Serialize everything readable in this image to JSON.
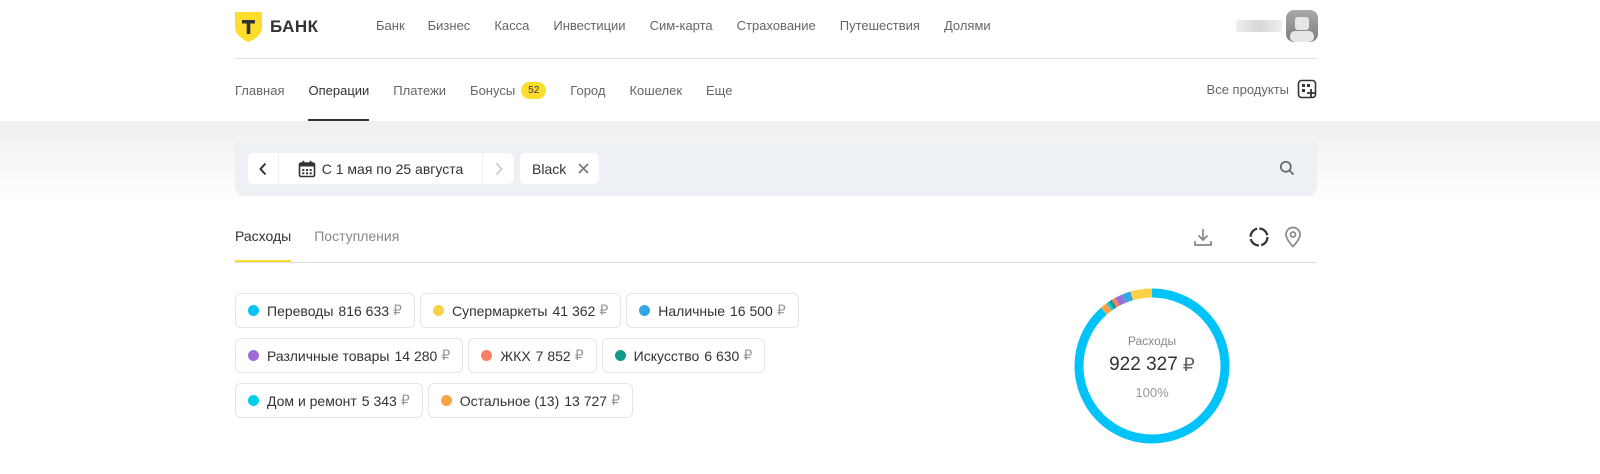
{
  "brand": {
    "logo_letter": "Т",
    "name": "БАНК",
    "accent": "#ffdd2d"
  },
  "top_nav": [
    "Банк",
    "Бизнес",
    "Касса",
    "Инвестиции",
    "Сим-карта",
    "Страхование",
    "Путешествия",
    "Долями"
  ],
  "sub_nav": {
    "items": [
      {
        "label": "Главная",
        "active": false
      },
      {
        "label": "Операции",
        "active": true
      },
      {
        "label": "Платежи",
        "active": false
      },
      {
        "label": "Бонусы",
        "badge": "52",
        "active": false
      },
      {
        "label": "Город",
        "active": false
      },
      {
        "label": "Кошелек",
        "active": false
      },
      {
        "label": "Еще",
        "active": false
      }
    ],
    "all_products": "Все продукты"
  },
  "filter": {
    "date_range": "С 1 мая по 25 августа",
    "card_chip": "Black"
  },
  "tabs": [
    {
      "label": "Расходы",
      "active": true
    },
    {
      "label": "Поступления",
      "active": false
    }
  ],
  "currency": "₽",
  "categories": [
    {
      "name": "Переводы",
      "amount": "816 633",
      "value": 816633,
      "color": "#00c3f9"
    },
    {
      "name": "Супермаркеты",
      "amount": "41 362",
      "value": 41362,
      "color": "#f9d046"
    },
    {
      "name": "Наличные",
      "amount": "16 500",
      "value": 16500,
      "color": "#33a7e6"
    },
    {
      "name": "Различные товары",
      "amount": "14 280",
      "value": 14280,
      "color": "#9b6ed6"
    },
    {
      "name": "ЖКХ",
      "amount": "7 852",
      "value": 7852,
      "color": "#fa7f63"
    },
    {
      "name": "Искусство",
      "amount": "6 630",
      "value": 6630,
      "color": "#109b8a"
    },
    {
      "name": "Дом и ремонт",
      "amount": "5 343",
      "value": 5343,
      "color": "#00cfe8"
    },
    {
      "name": "Остальное (13)",
      "amount": "13 727",
      "value": 13727,
      "color": "#f8a347"
    }
  ],
  "summary": {
    "label": "Расходы",
    "total": "922 327",
    "percent": "100%"
  }
}
